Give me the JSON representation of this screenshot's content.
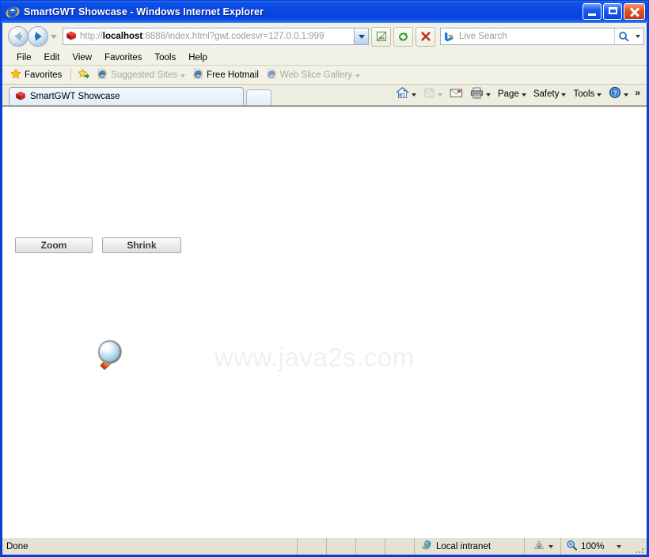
{
  "window": {
    "title": "SmartGWT Showcase - Windows Internet Explorer",
    "app_icon": "internet-explorer-icon",
    "controls": {
      "minimize": "Minimize",
      "maximize": "Maximize",
      "close": "Close"
    },
    "accent_title_blue": "#0A46E0",
    "close_red": "#E4562A"
  },
  "navigation": {
    "back_label": "Back",
    "forward_label": "Forward",
    "recent_pages_label": "Recent Pages",
    "address": {
      "favicon": "red-cube-icon",
      "scheme": "http://",
      "host": "localhost",
      "rest": ":8888/index.html?gwt.codesvr=127.0.0.1:999",
      "full_url": "http://localhost:8888/index.html?gwt.codesvr=127.0.0.1:999"
    },
    "buttons": {
      "compatibility_view": "Compatibility View",
      "refresh": "Refresh",
      "stop": "Stop"
    },
    "search": {
      "provider_icon": "bing-icon",
      "placeholder": "Live Search",
      "value": "",
      "go_label": "Search",
      "dropdown_label": "Search Options"
    }
  },
  "menubar": {
    "items": [
      {
        "label": "File"
      },
      {
        "label": "Edit"
      },
      {
        "label": "View"
      },
      {
        "label": "Favorites"
      },
      {
        "label": "Tools"
      },
      {
        "label": "Help"
      }
    ]
  },
  "favoritesbar": {
    "favorites_label": "Favorites",
    "add_label": "Add to Favorites Bar",
    "items": [
      {
        "label": "Suggested Sites",
        "icon": "ie-page-icon",
        "dim": true,
        "caret": true
      },
      {
        "label": "Free Hotmail",
        "icon": "ie-page-icon",
        "dim": false,
        "caret": false
      },
      {
        "label": "Web Slice Gallery",
        "icon": "ie-page-icon",
        "dim": true,
        "caret": true
      }
    ]
  },
  "tabs": {
    "items": [
      {
        "label": "SmartGWT Showcase",
        "icon": "red-cube-icon",
        "active": true
      }
    ],
    "new_tab_label": "New Tab"
  },
  "commandbar": {
    "items": [
      {
        "label": "",
        "icon": "home-icon",
        "caret": true,
        "dim": false
      },
      {
        "label": "",
        "icon": "rss-feed-icon",
        "caret": true,
        "dim": true
      },
      {
        "label": "",
        "icon": "mail-icon",
        "caret": false,
        "dim": false
      },
      {
        "label": "",
        "icon": "print-icon",
        "caret": true,
        "dim": false
      },
      {
        "label": "Page",
        "icon": "",
        "caret": true,
        "dim": false
      },
      {
        "label": "Safety",
        "icon": "",
        "caret": true,
        "dim": false
      },
      {
        "label": "Tools",
        "icon": "",
        "caret": true,
        "dim": false
      },
      {
        "label": "",
        "icon": "help-icon",
        "caret": true,
        "dim": false
      }
    ],
    "overflow_label": "»"
  },
  "page": {
    "buttons": [
      {
        "id": "zoom",
        "label": "Zoom"
      },
      {
        "id": "shrink",
        "label": "Shrink"
      }
    ],
    "image": {
      "name": "magnifier-image",
      "alt": "magnifying glass"
    },
    "watermark": "www.java2s.com"
  },
  "statusbar": {
    "status_text": "Done",
    "zone_icon": "globe-icon",
    "zone_label": "Local intranet",
    "protected_mode_icon": "lock-icon",
    "zoom_icon": "zoom-icon",
    "zoom_level": "100%"
  }
}
